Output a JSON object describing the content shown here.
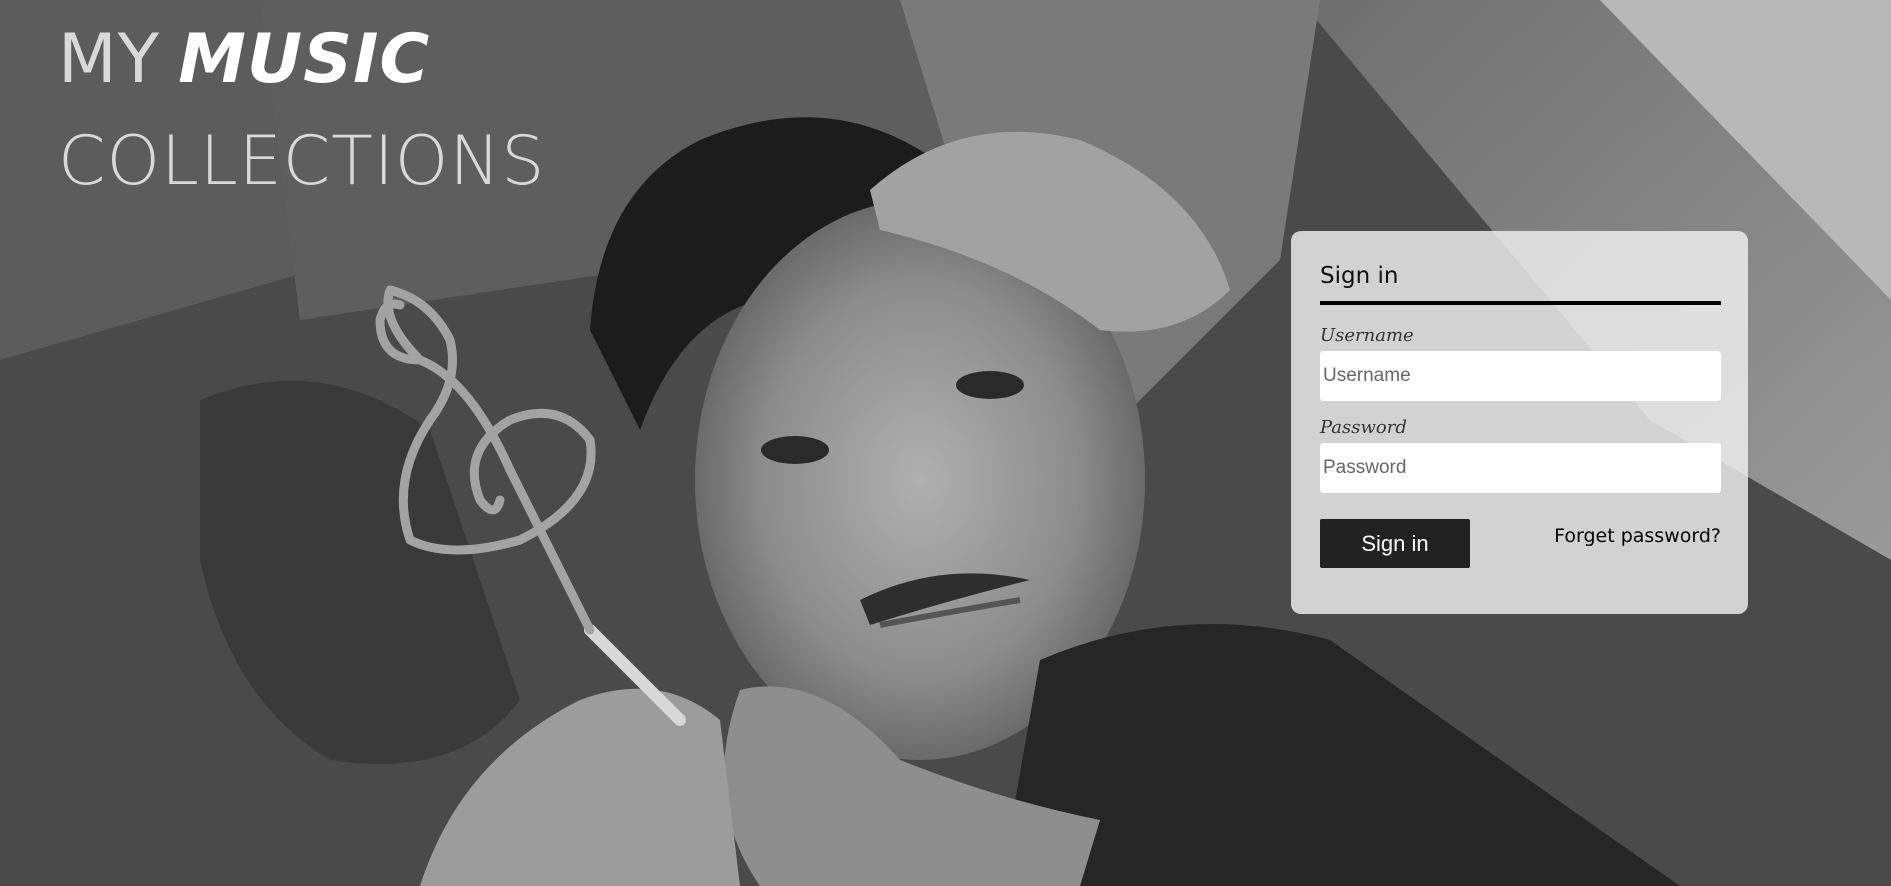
{
  "brand": {
    "line1_prefix": "MY",
    "line1_emphasis": "MUSIC",
    "line2": "COLLECTIONS"
  },
  "background": {
    "icon": "treble-clef-icon",
    "tone": "grayscale"
  },
  "login": {
    "title": "Sign in",
    "username_label": "Username",
    "username_placeholder": "Username",
    "username_value": "",
    "password_label": "Password",
    "password_placeholder": "Password",
    "password_value": "",
    "submit_label": "Sign in",
    "forgot_label": "Forget password?"
  },
  "colors": {
    "button_bg": "#222222",
    "card_bg": "#f0f0f0",
    "title_rule": "#000000"
  }
}
